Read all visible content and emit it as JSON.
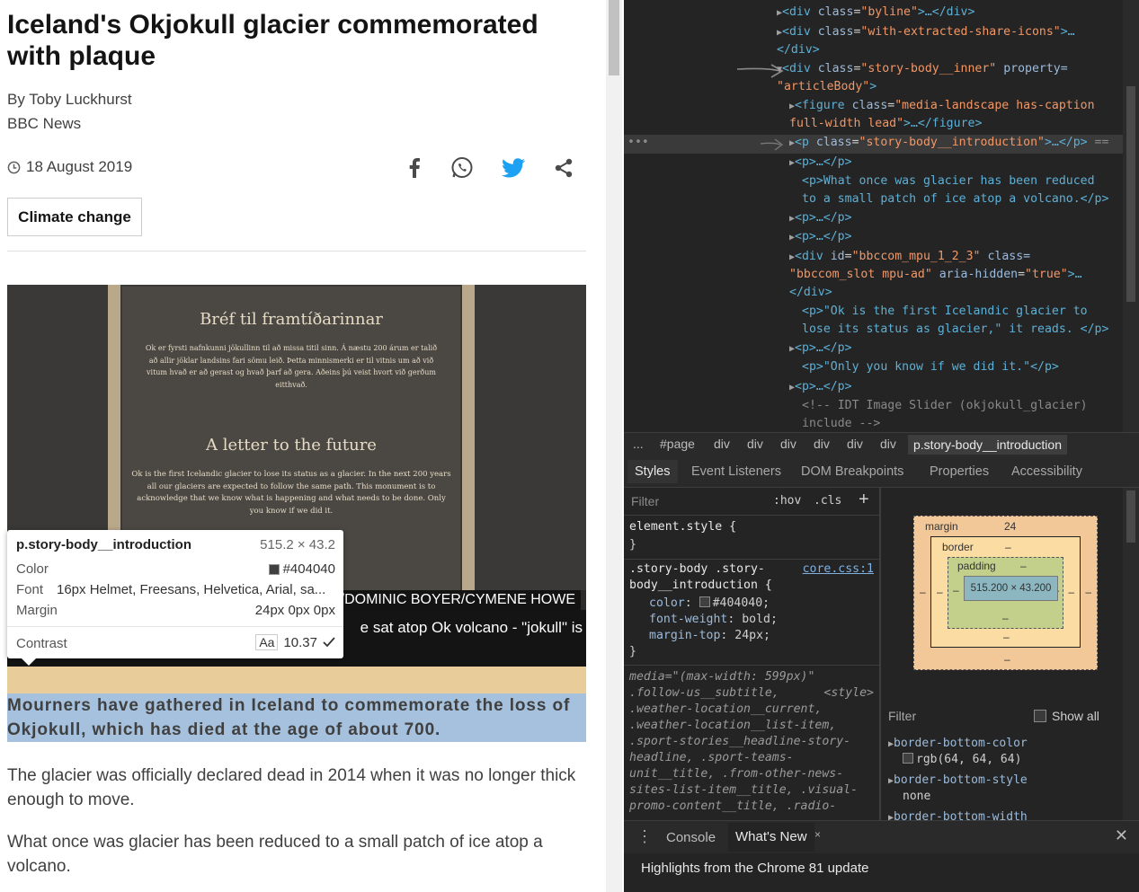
{
  "article": {
    "headline": "Iceland's Okjokull glacier commemorated with plaque",
    "byline_name": "By Toby Luckhurst",
    "byline_org": "BBC News",
    "date": "18 August 2019",
    "topic": "Climate change",
    "share_icons": [
      "facebook-icon",
      "whatsapp-icon",
      "twitter-icon",
      "share-icon"
    ],
    "plaque": {
      "title_is": "Bréf til framtíðarinnar",
      "text_is": "Ok er fyrsti nafnkunni jökullinn til að missa titil sinn. Á næstu 200 árum er talið að allir jöklar landsins fari sömu leið. Þetta minnismerki er til vitnis um að við vitum hvað er að gerast og hvað þarf að gera. Aðeins þú veist hvort við gerðum eitthvað.",
      "title_en": "A letter to the future",
      "text_en": "Ok is the first Icelandic glacier to lose its status as a glacier. In the next 200 years all our glaciers are expected to follow the same path. This monument is to acknowledge that we know what is happening and what needs to be done. Only you know if we did it."
    },
    "photo_credit": "/DOMINIC BOYER/CYMENE HOWE",
    "caption": "e sat atop Ok volcano - \"jokull\" is",
    "intro": "Mourners have gathered in Iceland to commemorate the loss of Okjokull, which has died at the age of about 700.",
    "para1": "The glacier was officially declared dead in 2014 when it was no longer thick enough to move.",
    "para2": "What once was glacier has been reduced to a small patch of ice atop a volcano."
  },
  "inspect_tooltip": {
    "selector": "p.story-body__introduction",
    "size": "515.2 × 43.2",
    "color_label": "Color",
    "color_value": "#404040",
    "font_label": "Font",
    "font_value": "16px Helmet, Freesans, Helvetica, Arial, sa...",
    "margin_label": "Margin",
    "margin_value": "24px 0px 0px",
    "contrast_label": "Contrast",
    "contrast_aa": "Aa",
    "contrast_value": "10.37"
  },
  "devtools": {
    "dom": {
      "l1_tag": "<div ",
      "l1_attr": "class",
      "l1_val": "\"byline\"",
      "l1_end": ">…</div>",
      "l2_tag": "<div ",
      "l2_attr": "class",
      "l2_val": "\"with-extracted-share-icons\"",
      "l2_end": ">…",
      "l3": "</div>",
      "l4_tag": "<div ",
      "l4_attr": "class",
      "l4_val": "\"story-body__inner\"",
      "l4_attr2": " property=",
      "l5_val": "\"articleBody\"",
      "l5_end": ">",
      "l6_tag": "<figure ",
      "l6_attr": "class",
      "l6_val": "\"media-landscape has-caption",
      "l7_val": "full-width lead\"",
      "l7_end": ">…</figure>",
      "l8_tag": "<p ",
      "l8_attr": "class",
      "l8_val": "\"story-body__introduction\"",
      "l8_end": ">…</p>",
      "l8_eq": "==",
      "l9": "<p>…</p>",
      "l10": "<p>What once was glacier has been reduced",
      "l11": "to a small patch of ice atop a volcano.</p>",
      "l12": "<p>…</p>",
      "l13": "<p>…</p>",
      "l14_tag": "<div ",
      "l14_attr": "id",
      "l14_val": "\"bbccom_mpu_1_2_3\"",
      "l14_attr2": " class=",
      "l15_val": "\"bbccom_slot mpu-ad\"",
      "l15_attr": " aria-hidden",
      "l15_val2": "\"true\"",
      "l15_end": ">…",
      "l16": "</div>",
      "l17": "<p>\"Ok is the first Icelandic glacier to",
      "l18": "lose its status as glacier,\" it reads. </p>",
      "l19": "<p>…</p>",
      "l20": "<p>\"Only you know if we did it.\"</p>",
      "l21": "<p>…</p>",
      "l22": "<!-- IDT Image Slider (okjokull_glacier)",
      "l23": "include -->"
    },
    "breadcrumbs": [
      "...",
      "#page",
      "div",
      "div",
      "div",
      "div",
      "div",
      "div",
      "p.story-body__introduction"
    ],
    "subtabs": [
      "Styles",
      "Event Listeners",
      "DOM Breakpoints",
      "Properties",
      "Accessibility"
    ],
    "styles": {
      "filter_placeholder": "Filter",
      "hov": ":hov",
      "cls": ".cls",
      "plus": "+",
      "element_style": "element.style {",
      "close_brace": "}",
      "rule_selector_1": ".story-body .story-",
      "rule_selector_2": "body__introduction {",
      "rule_link": "core.css:1",
      "prop_color": "color",
      "val_color": "#404040;",
      "prop_weight": "font-weight",
      "val_weight": "bold;",
      "prop_margin": "margin-top",
      "val_margin": "24px;",
      "media": "media=\"(max-width: 599px)\"",
      "media_sel_1": ".follow-us__subtitle,",
      "media_style": "<style>",
      "media_sel_2": ".weather-location__current,",
      "media_sel_3": ".weather-location__list-item,",
      "media_sel_4": ".sport-stories__headline-story-",
      "media_sel_5": "headline, .sport-teams-",
      "media_sel_6": "unit__title, .from-other-news-",
      "media_sel_7": "sites-list-item__title, .visual-",
      "media_sel_8": "promo-content__title, .radio-"
    },
    "box_model": {
      "margin_label": "margin",
      "margin_value": "24",
      "border_label": "border",
      "border_value": "–",
      "padding_label": "padding",
      "padding_value": "–",
      "content_value": "515.200 × 43.200",
      "dash": "–"
    },
    "computed": {
      "filter_label": "Filter",
      "show_all": "Show all",
      "p1_name": "border-bottom-color",
      "p1_value": "rgb(64, 64, 64)",
      "p2_name": "border-bottom-style",
      "p2_value": "none",
      "p3_name": "border-bottom-width"
    },
    "drawer": {
      "menu": "⋮",
      "console": "Console",
      "whats_new": "What's New",
      "tab_close": "×",
      "close": "✕",
      "message": "Highlights from the Chrome 81 update"
    }
  },
  "colors": {
    "text": "#404040",
    "devtools_bg": "#242424",
    "margin_highlight": "#e4c489",
    "content_highlight": "#87acd2",
    "twitter": "#1da1f2"
  }
}
